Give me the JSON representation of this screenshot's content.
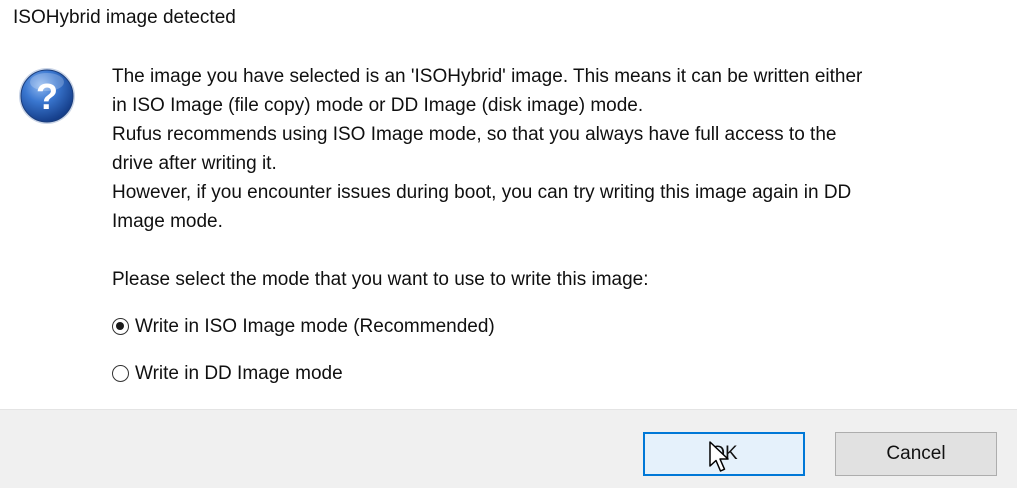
{
  "window": {
    "title": "ISOHybrid image detected"
  },
  "icon": {
    "name": "question-icon",
    "color": "#1f5fb8"
  },
  "message": {
    "lines": [
      "The image you have selected is an 'ISOHybrid' image. This means it can be written either",
      "in ISO Image (file copy) mode or DD Image (disk image) mode.",
      "Rufus recommends using ISO Image mode, so that you always have full access to the",
      "drive after writing it.",
      "However, if you encounter issues during boot, you can try writing this image again in DD",
      "Image mode."
    ],
    "prompt": "Please select the mode that you want to use to write this image:"
  },
  "options": [
    {
      "label": "Write in ISO Image mode (Recommended)",
      "selected": true
    },
    {
      "label": "Write in DD Image mode",
      "selected": false
    }
  ],
  "buttons": {
    "ok_label": "OK",
    "cancel_label": "Cancel"
  },
  "colors": {
    "accent": "#0078d7",
    "footer_background": "#f0f0f0"
  }
}
